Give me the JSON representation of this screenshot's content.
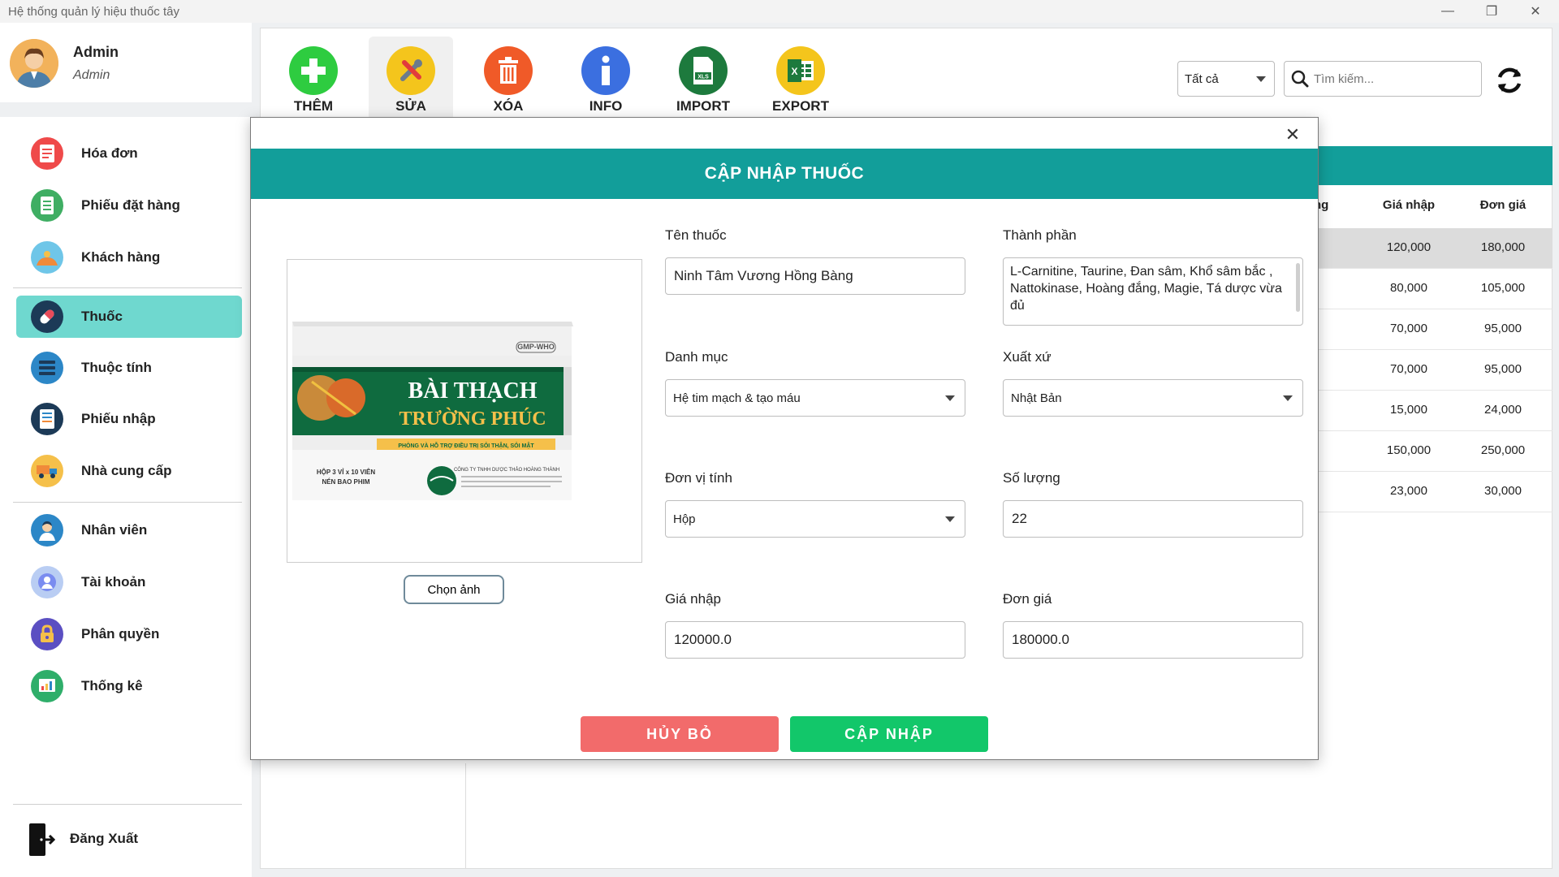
{
  "window": {
    "title": "Hệ thống quản lý hiệu thuốc tây"
  },
  "user": {
    "name": "Admin",
    "role": "Admin"
  },
  "sidebar": {
    "items": [
      {
        "label": "Hóa đơn"
      },
      {
        "label": "Phiếu đặt hàng"
      },
      {
        "label": "Khách hàng"
      },
      {
        "label": "Thuốc"
      },
      {
        "label": "Thuộc tính"
      },
      {
        "label": "Phiếu nhập"
      },
      {
        "label": "Nhà cung cấp"
      },
      {
        "label": "Nhân viên"
      },
      {
        "label": "Tài khoản"
      },
      {
        "label": "Phân quyền"
      },
      {
        "label": "Thống kê"
      }
    ],
    "active_item": "Thuốc",
    "logout_label": "Đăng Xuất"
  },
  "toolbar": {
    "buttons": [
      {
        "label": "THÊM",
        "icon": "plus-icon",
        "color": "#2ecc40"
      },
      {
        "label": "SỬA",
        "icon": "wrench-icon",
        "color": "#f4c51c"
      },
      {
        "label": "XÓA",
        "icon": "trash-icon",
        "color": "#f05a28"
      },
      {
        "label": "INFO",
        "icon": "info-icon",
        "color": "#3b6fe0"
      },
      {
        "label": "IMPORT",
        "icon": "xls-icon",
        "color": "#1d7a3d"
      },
      {
        "label": "EXPORT",
        "icon": "excel-icon",
        "color": "#f4c51c"
      }
    ],
    "filter_value": "Tất cả",
    "search_placeholder": "Tìm kiếm..."
  },
  "table": {
    "header_partial": "ng",
    "headers": [
      "Giá nhập",
      "Đơn giá"
    ],
    "rows": [
      [
        "120,000",
        "180,000"
      ],
      [
        "80,000",
        "105,000"
      ],
      [
        "70,000",
        "95,000"
      ],
      [
        "70,000",
        "95,000"
      ],
      [
        "15,000",
        "24,000"
      ],
      [
        "150,000",
        "250,000"
      ],
      [
        "23,000",
        "30,000"
      ]
    ]
  },
  "modal": {
    "title": "CẬP NHẬP THUỐC",
    "choose_image_label": "Chọn ảnh",
    "product_image": {
      "badge": "GMP-WHO",
      "line1": "BÀI THẠCH",
      "line2": "TRƯỜNG PHÚC",
      "tagline": "PHÒNG VÀ HỖ TRỢ ĐIỀU TRỊ SỎI THẬN, SỎI MẬT",
      "pack_line1": "HỘP 3 VỈ x 10 VIÊN",
      "pack_line2": "NÉN BAO PHIM",
      "maker": "CÔNG TY TNHH DƯỢC THẢO HOÀNG THÀNH"
    },
    "fields": {
      "name": {
        "label": "Tên thuốc",
        "value": "Ninh Tâm Vương Hồng Bàng"
      },
      "ingredients": {
        "label": "Thành phần",
        "value": "L-Carnitine, Taurine, Đan sâm, Khổ sâm bắc , Nattokinase, Hoàng đắng, Magie, Tá dược vừa đủ"
      },
      "category": {
        "label": "Danh mục",
        "value": "Hệ tim mạch & tạo máu"
      },
      "origin": {
        "label": "Xuất xứ",
        "value": "Nhật Bản"
      },
      "unit": {
        "label": "Đơn vị tính",
        "value": "Hộp"
      },
      "quantity": {
        "label": "Số lượng",
        "value": "22"
      },
      "import_price": {
        "label": "Giá nhập",
        "value": "120000.0"
      },
      "unit_price": {
        "label": "Đơn giá",
        "value": "180000.0"
      }
    },
    "cancel_label": "HỦY BỎ",
    "update_label": "CẬP NHẬP"
  }
}
